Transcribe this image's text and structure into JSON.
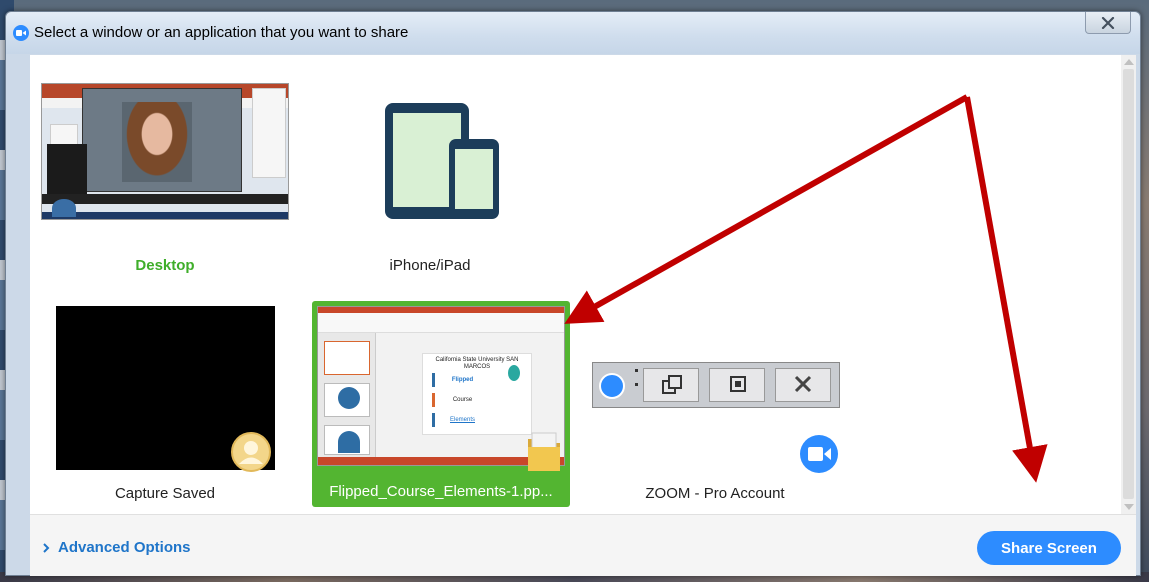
{
  "window": {
    "title": "Select a window or an application that you want to share"
  },
  "tiles": {
    "desktop": {
      "label": "Desktop"
    },
    "iphone": {
      "label": "iPhone/iPad"
    },
    "capture": {
      "label": "Capture Saved"
    },
    "ppt": {
      "label": "Flipped_Course_Elements-1.pp...",
      "thumb_university": "California State University SAN MARCOS",
      "thumb_items": [
        "Flipped",
        "Course",
        "Elements"
      ]
    },
    "zoom": {
      "label": "ZOOM - Pro Account"
    }
  },
  "footer": {
    "advanced_options": "Advanced Options",
    "share_button": "Share Screen"
  },
  "colors": {
    "accent": "#2d8cff",
    "selected": "#53b531",
    "arrow": "#c00000",
    "label_green": "#3fae2a"
  },
  "icons": [
    "zoom-logo-icon",
    "close-icon",
    "tablet-phone-icon",
    "folder-icon",
    "user-icon",
    "chevron-right-icon"
  ]
}
